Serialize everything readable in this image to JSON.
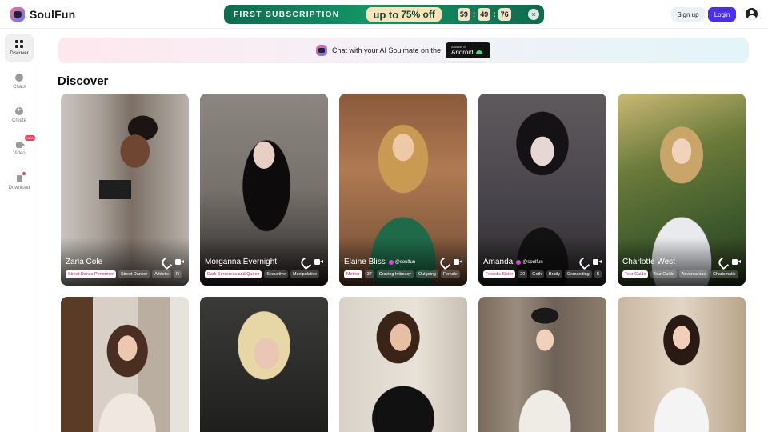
{
  "app": {
    "name": "SoulFun"
  },
  "promo": {
    "title": "FIRST SUBSCRIPTION",
    "offer_prefix": "up to",
    "offer_value": "75% off",
    "timer": [
      "59",
      "49",
      "76"
    ],
    "close": "×"
  },
  "header": {
    "signup_label": "Sign up",
    "login_label": "Login"
  },
  "sidebar": {
    "items": [
      {
        "label": "Discover",
        "icon": "grid-icon"
      },
      {
        "label": "Chats",
        "icon": "chat-icon"
      },
      {
        "label": "Create",
        "icon": "plus-circle-icon"
      },
      {
        "label": "Video",
        "icon": "video-icon",
        "badge": "NEW"
      },
      {
        "label": "Download",
        "icon": "phone-download-icon"
      }
    ]
  },
  "banner": {
    "text": "Chat with your AI Soulmate on the",
    "badge_small": "Available on",
    "badge_big": "Android"
  },
  "section": {
    "title": "Discover"
  },
  "cards": [
    {
      "name": "Zaria Cole",
      "handle": "",
      "tags": [
        "Street Dance Performer",
        "Street Dancer",
        "Athletic",
        "Fi"
      ]
    },
    {
      "name": "Morganna Evernight",
      "handle": "",
      "tags": [
        "Dark Sorceress and Queen",
        "Seductive",
        "Manipulative"
      ]
    },
    {
      "name": "Elaine Bliss",
      "handle": "@soulfun",
      "tags": [
        "Mother",
        "37",
        "Craving Intimacy",
        "Outgoing",
        "Female"
      ]
    },
    {
      "name": "Amanda",
      "handle": "@soulfun",
      "tags": [
        "Friend's Sister",
        "20",
        "Goth",
        "Bratty",
        "Demanding",
        "S"
      ]
    },
    {
      "name": "Charlotte West",
      "handle": "",
      "tags": [
        "Tour Guide",
        "Tour Guide",
        "Adventurous",
        "Charismatic"
      ]
    }
  ],
  "colors": {
    "accent": "#4b2ef0",
    "promo_green": "#149467",
    "tag_primary_text": "#c8205a"
  }
}
